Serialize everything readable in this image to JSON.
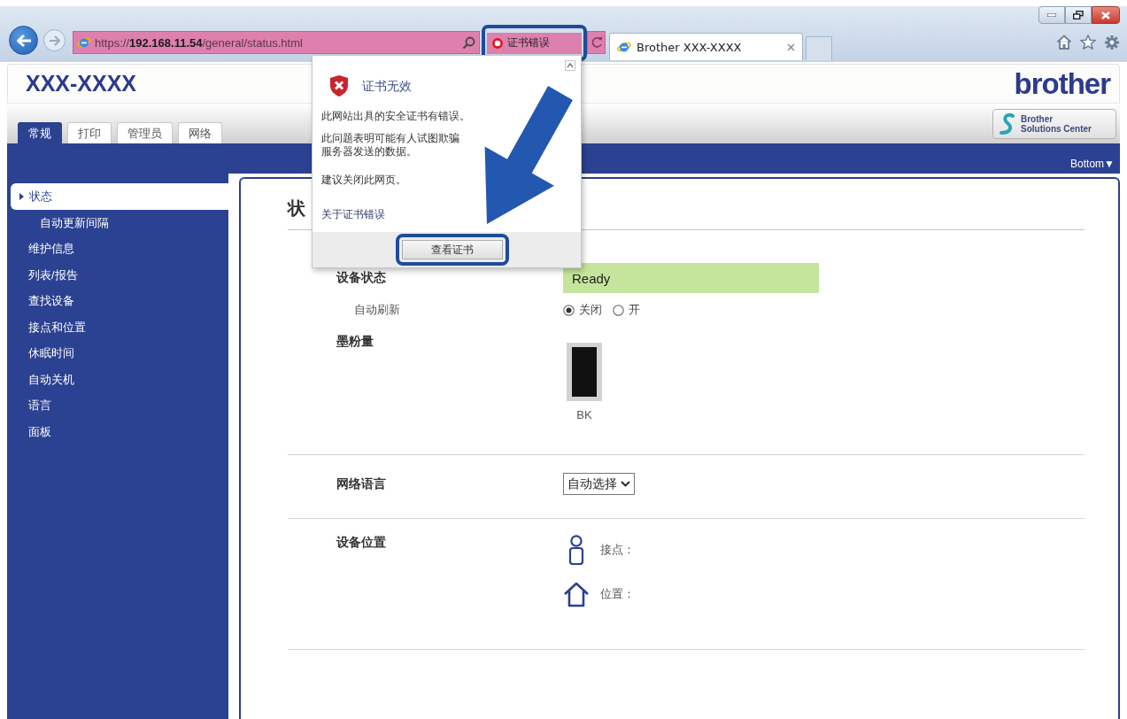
{
  "browser": {
    "address": "https://**192.168.11.54**/general/status.html",
    "certificate_alert": "证书错误",
    "tab_title": "Brother XXX-XXXX"
  },
  "page": {
    "model": "XXX-XXXX",
    "brand": "brother",
    "solutions_button": [
      "Brother",
      "Solutions Center"
    ],
    "tabs": [
      {
        "label": "常规",
        "selected": true
      },
      {
        "label": "打印",
        "selected": false
      },
      {
        "label": "管理员",
        "selected": false
      },
      {
        "label": "网络",
        "selected": false
      }
    ],
    "bottom_link": "Bottom▼",
    "sidebar": [
      {
        "label": "状态",
        "selected": true,
        "children": [
          {
            "label": "自动更新间隔",
            "selected": false
          }
        ]
      },
      {
        "label": "维护信息",
        "selected": false
      },
      {
        "label": "列表/报告",
        "selected": false
      },
      {
        "label": "查找设备",
        "selected": false
      },
      {
        "label": "接点和位置",
        "selected": false
      },
      {
        "label": "休眠时间",
        "selected": false
      },
      {
        "label": "自动关机",
        "selected": false
      },
      {
        "label": "语言",
        "selected": false
      },
      {
        "label": "面板",
        "selected": false
      }
    ],
    "heading": "状",
    "sections": [
      {
        "rows": [
          {
            "kind": "status",
            "label": "设备状态",
            "value": "Ready"
          },
          {
            "kind": "radio",
            "label": "自动刷新",
            "options": [
              {
                "label": "关闭",
                "selected": true
              },
              {
                "label": "开",
                "selected": false
              }
            ]
          },
          {
            "kind": "toner",
            "label": "墨粉量",
            "cartridges": [
              {
                "name": "BK",
                "level": 1
              }
            ]
          }
        ]
      },
      {
        "rows": [
          {
            "kind": "select",
            "label": "网络语言",
            "value": "自动选择"
          }
        ]
      },
      {
        "rows": [
          {
            "kind": "location",
            "label": "设备位置",
            "entries": [
              {
                "kind": "contact",
                "label": "接点："
              },
              {
                "kind": "place",
                "label": "位置："
              }
            ]
          }
        ]
      }
    ]
  },
  "popup": {
    "title": "证书无效",
    "message": "此网站出具的安全证书有错误。",
    "detail_lines": [
      "此问题表明可能有人试图欺骗",
      "服务器发送的数据。"
    ],
    "advice": "建议关闭此网页。",
    "link": "关于证书错误",
    "button": "查看证书"
  }
}
